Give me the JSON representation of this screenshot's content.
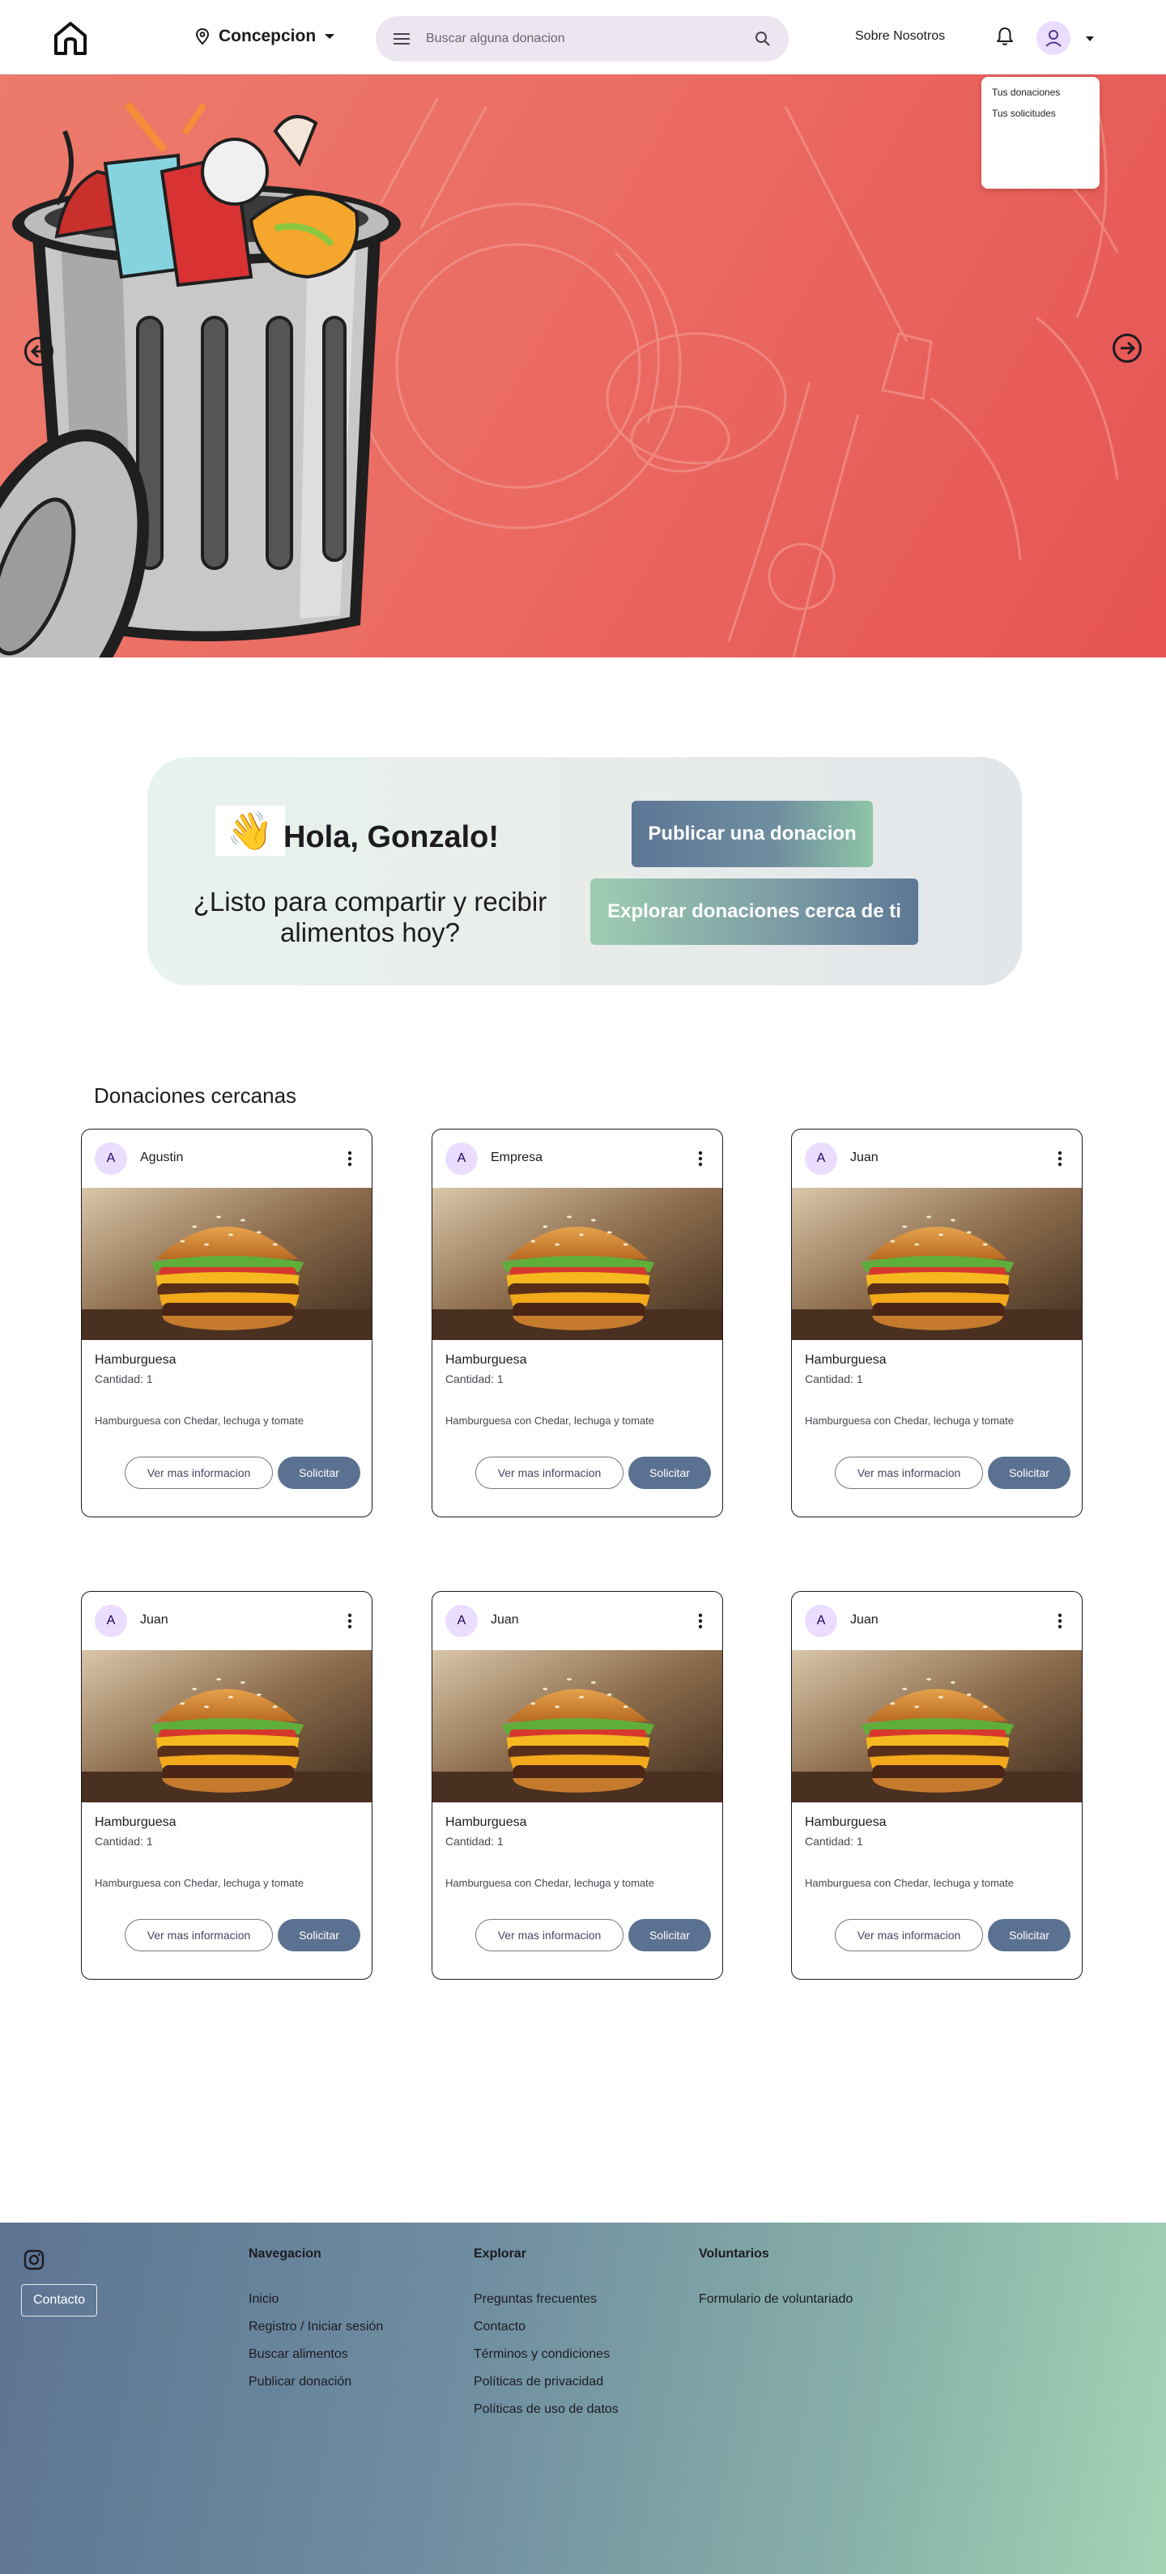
{
  "header": {
    "location": "Concepcion",
    "search_placeholder": "Buscar alguna donacion",
    "about_label": "Sobre Nosotros"
  },
  "user_menu": {
    "items": [
      "Tus donaciones",
      "Tus solicitudes"
    ]
  },
  "greeting": {
    "emoji": "👋",
    "title": "Hola, Gonzalo!",
    "subtitle": "¿Listo para compartir y recibir alimentos hoy?",
    "publish_label": "Publicar una donacion",
    "explore_label": "Explorar donaciones cerca de ti"
  },
  "nearby": {
    "title": "Donaciones cercanas",
    "more_info_label": "Ver mas informacion",
    "request_label": "Solicitar",
    "cards": [
      {
        "initial": "A",
        "donor": "Agustin",
        "title": "Hamburguesa",
        "quantity": "Cantidad: 1",
        "description": "Hamburguesa con Chedar, lechuga y tomate"
      },
      {
        "initial": "A",
        "donor": "Empresa",
        "title": "Hamburguesa",
        "quantity": "Cantidad: 1",
        "description": "Hamburguesa con Chedar, lechuga y tomate"
      },
      {
        "initial": "A",
        "donor": "Juan",
        "title": "Hamburguesa",
        "quantity": "Cantidad: 1",
        "description": "Hamburguesa con Chedar, lechuga y tomate"
      },
      {
        "initial": "A",
        "donor": "Juan",
        "title": "Hamburguesa",
        "quantity": "Cantidad: 1",
        "description": "Hamburguesa con Chedar, lechuga y tomate"
      },
      {
        "initial": "A",
        "donor": "Juan",
        "title": "Hamburguesa",
        "quantity": "Cantidad: 1",
        "description": "Hamburguesa con Chedar, lechuga y tomate"
      },
      {
        "initial": "A",
        "donor": "Juan",
        "title": "Hamburguesa",
        "quantity": "Cantidad: 1",
        "description": "Hamburguesa con Chedar, lechuga y tomate"
      }
    ]
  },
  "footer": {
    "contact_label": "Contacto",
    "navegacion": {
      "title": "Navegacion",
      "links": [
        "Inicio",
        "Registro / Iniciar sesión",
        "Buscar alimentos",
        "Publicar donación"
      ]
    },
    "explorar": {
      "title": "Explorar",
      "links": [
        "Preguntas frecuentes",
        "Contacto",
        "Términos y condiciones",
        "Políticas de privacidad",
        "Políticas de uso de datos"
      ]
    },
    "voluntarios": {
      "title": "Voluntarios",
      "links": [
        "Formulario de voluntariado"
      ]
    }
  },
  "colors": {
    "hero_red": "#e65453",
    "accent_blue": "#5b7191",
    "accent_green": "#a3d4b5",
    "avatar_bg": "#eaddff"
  },
  "icons": {
    "home": "home-icon",
    "location": "location-pin-icon",
    "menu": "menu-icon",
    "search": "search-icon",
    "bell": "bell-icon",
    "user": "user-icon",
    "instagram": "instagram-icon"
  }
}
